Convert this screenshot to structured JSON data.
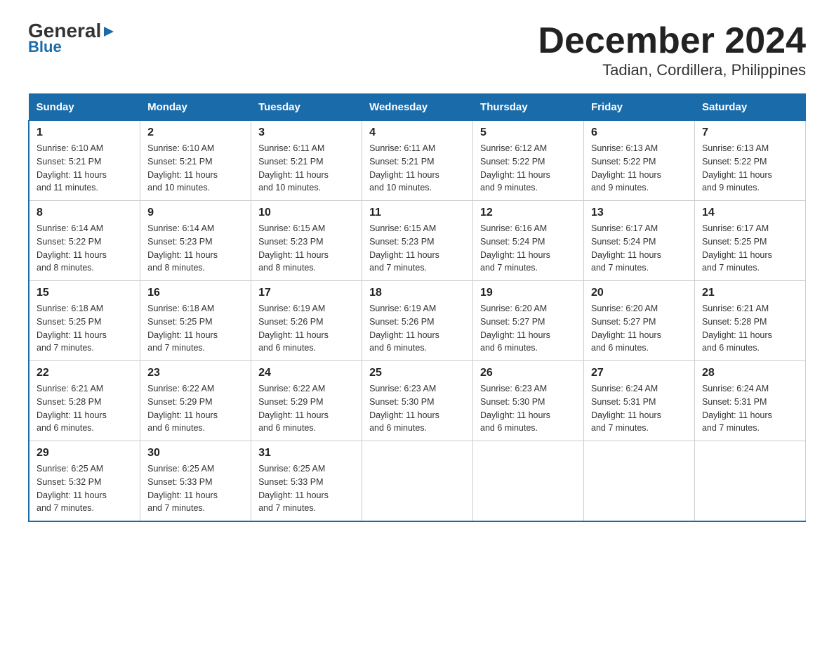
{
  "logo": {
    "top": "General",
    "arrow": "▶",
    "bottom": "Blue"
  },
  "title": "December 2024",
  "subtitle": "Tadian, Cordillera, Philippines",
  "days_of_week": [
    "Sunday",
    "Monday",
    "Tuesday",
    "Wednesday",
    "Thursday",
    "Friday",
    "Saturday"
  ],
  "weeks": [
    [
      {
        "day": "1",
        "info": "Sunrise: 6:10 AM\nSunset: 5:21 PM\nDaylight: 11 hours\nand 11 minutes."
      },
      {
        "day": "2",
        "info": "Sunrise: 6:10 AM\nSunset: 5:21 PM\nDaylight: 11 hours\nand 10 minutes."
      },
      {
        "day": "3",
        "info": "Sunrise: 6:11 AM\nSunset: 5:21 PM\nDaylight: 11 hours\nand 10 minutes."
      },
      {
        "day": "4",
        "info": "Sunrise: 6:11 AM\nSunset: 5:21 PM\nDaylight: 11 hours\nand 10 minutes."
      },
      {
        "day": "5",
        "info": "Sunrise: 6:12 AM\nSunset: 5:22 PM\nDaylight: 11 hours\nand 9 minutes."
      },
      {
        "day": "6",
        "info": "Sunrise: 6:13 AM\nSunset: 5:22 PM\nDaylight: 11 hours\nand 9 minutes."
      },
      {
        "day": "7",
        "info": "Sunrise: 6:13 AM\nSunset: 5:22 PM\nDaylight: 11 hours\nand 9 minutes."
      }
    ],
    [
      {
        "day": "8",
        "info": "Sunrise: 6:14 AM\nSunset: 5:22 PM\nDaylight: 11 hours\nand 8 minutes."
      },
      {
        "day": "9",
        "info": "Sunrise: 6:14 AM\nSunset: 5:23 PM\nDaylight: 11 hours\nand 8 minutes."
      },
      {
        "day": "10",
        "info": "Sunrise: 6:15 AM\nSunset: 5:23 PM\nDaylight: 11 hours\nand 8 minutes."
      },
      {
        "day": "11",
        "info": "Sunrise: 6:15 AM\nSunset: 5:23 PM\nDaylight: 11 hours\nand 7 minutes."
      },
      {
        "day": "12",
        "info": "Sunrise: 6:16 AM\nSunset: 5:24 PM\nDaylight: 11 hours\nand 7 minutes."
      },
      {
        "day": "13",
        "info": "Sunrise: 6:17 AM\nSunset: 5:24 PM\nDaylight: 11 hours\nand 7 minutes."
      },
      {
        "day": "14",
        "info": "Sunrise: 6:17 AM\nSunset: 5:25 PM\nDaylight: 11 hours\nand 7 minutes."
      }
    ],
    [
      {
        "day": "15",
        "info": "Sunrise: 6:18 AM\nSunset: 5:25 PM\nDaylight: 11 hours\nand 7 minutes."
      },
      {
        "day": "16",
        "info": "Sunrise: 6:18 AM\nSunset: 5:25 PM\nDaylight: 11 hours\nand 7 minutes."
      },
      {
        "day": "17",
        "info": "Sunrise: 6:19 AM\nSunset: 5:26 PM\nDaylight: 11 hours\nand 6 minutes."
      },
      {
        "day": "18",
        "info": "Sunrise: 6:19 AM\nSunset: 5:26 PM\nDaylight: 11 hours\nand 6 minutes."
      },
      {
        "day": "19",
        "info": "Sunrise: 6:20 AM\nSunset: 5:27 PM\nDaylight: 11 hours\nand 6 minutes."
      },
      {
        "day": "20",
        "info": "Sunrise: 6:20 AM\nSunset: 5:27 PM\nDaylight: 11 hours\nand 6 minutes."
      },
      {
        "day": "21",
        "info": "Sunrise: 6:21 AM\nSunset: 5:28 PM\nDaylight: 11 hours\nand 6 minutes."
      }
    ],
    [
      {
        "day": "22",
        "info": "Sunrise: 6:21 AM\nSunset: 5:28 PM\nDaylight: 11 hours\nand 6 minutes."
      },
      {
        "day": "23",
        "info": "Sunrise: 6:22 AM\nSunset: 5:29 PM\nDaylight: 11 hours\nand 6 minutes."
      },
      {
        "day": "24",
        "info": "Sunrise: 6:22 AM\nSunset: 5:29 PM\nDaylight: 11 hours\nand 6 minutes."
      },
      {
        "day": "25",
        "info": "Sunrise: 6:23 AM\nSunset: 5:30 PM\nDaylight: 11 hours\nand 6 minutes."
      },
      {
        "day": "26",
        "info": "Sunrise: 6:23 AM\nSunset: 5:30 PM\nDaylight: 11 hours\nand 6 minutes."
      },
      {
        "day": "27",
        "info": "Sunrise: 6:24 AM\nSunset: 5:31 PM\nDaylight: 11 hours\nand 7 minutes."
      },
      {
        "day": "28",
        "info": "Sunrise: 6:24 AM\nSunset: 5:31 PM\nDaylight: 11 hours\nand 7 minutes."
      }
    ],
    [
      {
        "day": "29",
        "info": "Sunrise: 6:25 AM\nSunset: 5:32 PM\nDaylight: 11 hours\nand 7 minutes."
      },
      {
        "day": "30",
        "info": "Sunrise: 6:25 AM\nSunset: 5:33 PM\nDaylight: 11 hours\nand 7 minutes."
      },
      {
        "day": "31",
        "info": "Sunrise: 6:25 AM\nSunset: 5:33 PM\nDaylight: 11 hours\nand 7 minutes."
      },
      {
        "day": "",
        "info": ""
      },
      {
        "day": "",
        "info": ""
      },
      {
        "day": "",
        "info": ""
      },
      {
        "day": "",
        "info": ""
      }
    ]
  ]
}
